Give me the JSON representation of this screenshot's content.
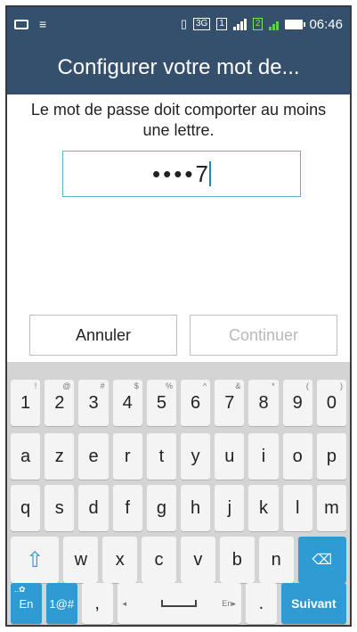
{
  "status_bar": {
    "time": "06:46",
    "sim1": "1",
    "sim2": "2",
    "network": "3G"
  },
  "title": "Configurer votre mot de...",
  "message": "Le mot de passe doit comporter au moins une lettre.",
  "password": {
    "masked": "••••",
    "last_char": "7"
  },
  "buttons": {
    "cancel": "Annuler",
    "continue": "Continuer"
  },
  "keyboard": {
    "number_row": [
      {
        "main": "1",
        "alt": "!"
      },
      {
        "main": "2",
        "alt": "@"
      },
      {
        "main": "3",
        "alt": "#"
      },
      {
        "main": "4",
        "alt": "$"
      },
      {
        "main": "5",
        "alt": "%"
      },
      {
        "main": "6",
        "alt": "^"
      },
      {
        "main": "7",
        "alt": "&"
      },
      {
        "main": "8",
        "alt": "*"
      },
      {
        "main": "9",
        "alt": "("
      },
      {
        "main": "0",
        "alt": ")"
      }
    ],
    "row1": [
      "a",
      "z",
      "e",
      "r",
      "t",
      "y",
      "u",
      "i",
      "o",
      "p"
    ],
    "row2": [
      "q",
      "s",
      "d",
      "f",
      "g",
      "h",
      "j",
      "k",
      "l",
      "m"
    ],
    "row3": [
      "w",
      "x",
      "c",
      "v",
      "b",
      "n"
    ],
    "shift_icon": "shift-arrow",
    "backspace_icon": "backspace-x",
    "lang": "En",
    "symbols": "1@#",
    "comma": ",",
    "period": ".",
    "space_hint": "En",
    "send": "Suivant",
    "accent_color": "#2f9bd3"
  }
}
